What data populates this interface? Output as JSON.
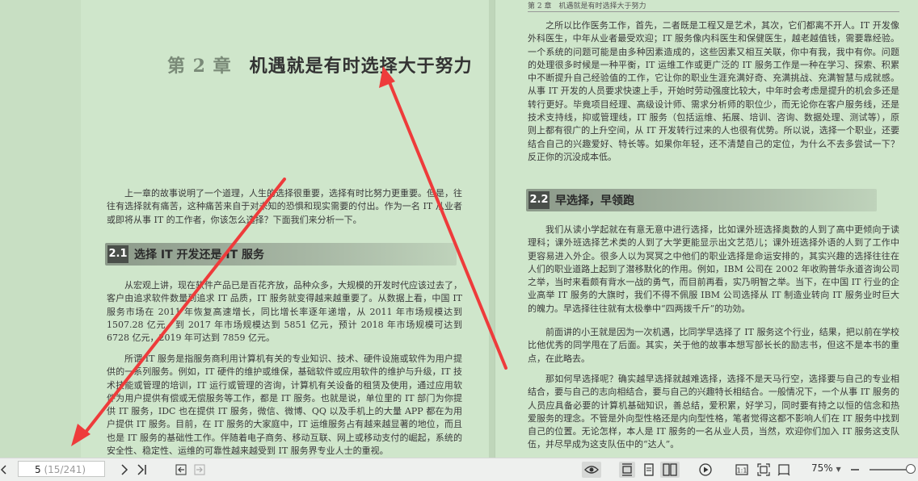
{
  "left_page": {
    "chapter_number": "第 2 章",
    "chapter_title": "机遇就是有时选择大于努力",
    "intro_paragraph": "上一章的故事说明了一个道理，人生的选择很重要，选择有时比努力更重要。但是，往往有选择就有痛苦，这种痛苦来自于对未知的恐惧和现实需要的付出。作为一名 IT 从业者或即将从事 IT 的工作者，你该怎么选择？下面我们来分析一下。",
    "section_badge": "2.1",
    "section_title": "选择 IT 开发还是 IT 服务",
    "para1": "从宏观上讲，现在软件产品已是百花齐放，品种众多，大规模的开发时代应该过去了，客户由追求软件数量到追求 IT 品质，IT 服务就变得越来越重要了。从数据上看，中国 IT 服务市场在 2011 年恢复高速增长，同比增长率逐年递增，从 2011 年市场规模达到 1507.28 亿元，到 2017 年市场规模达到 5851 亿元，预计 2018 年市场规模可达到 6728 亿元，2019 年可达到 7859 亿元。",
    "para2": "所谓 IT 服务是指服务商利用计算机有关的专业知识、技术、硬件设施或软件为用户提供的一系列服务。例如，IT 硬件的维护或维保，基础软件或应用软件的维护与升级，IT 技术技能或管理的培训，IT 运行或管理的咨询，计算机有关设备的租赁及使用，通过应用软件为用户提供有偿或无偿服务等工作，都是 IT 服务。也就是说，单位里的 IT 部门为你提供 IT 服务，IDC 也在提供 IT 服务，微信、微博、QQ 以及手机上的大量 APP 都在为用户提供 IT 服务。目前，在 IT 服务的大家庭中，IT 运维服务占有越来越显著的地位，而且也是 IT 服务的基础性工作。伴随着电子商务、移动互联、网上或移动支付的崛起，系统的安全性、稳定性、运维的可靠性越来越受到 IT 服务界专业人士的重视。"
  },
  "right_page": {
    "running_head": "第 2 章　机遇就是有时选择大于努力",
    "para_top": "之所以比作医务工作，首先，二者既是工程又是艺术，其次，它们都离不开人。IT 开发像外科医生，中年从业者最受欢迎；IT 服务像内科医生和保健医生，越老越值钱，需要靠经验。一个系统的问题可能是由多种因素造成的，这些因素又相互关联，你中有我，我中有你。问题的处理很多时候是一种平衡，IT 运维工作或更广泛的 IT 服务工作是一种在学习、探索、积累中不断提升自己经验值的工作，它让你的职业生涯充满好奇、充满挑战、充满智慧与成就感。从事 IT 开发的人员要求快速上手，开始时劳动强度比较大，中年时会考虑是提升的机会多还是转行更好。毕竟项目经理、高级设计师、需求分析师的职位少，而无论你在客户服务线，还是技术支持线，抑或管理线，IT 服务（包括运维、拓展、培训、咨询、数据处理、测试等），原则上都有很广的上升空间，从 IT 开发转行过来的人也很有优势。所以说，选择一个职业，还要结合自己的兴趣爱好、特长等。如果你年轻，还不清楚自己的定位，为什么不去多尝试一下？反正你的沉没成本低。",
    "section_badge": "2.2",
    "section_title": "早选择，早领跑",
    "para1": "我们从读小学起就在有意无意中进行选择，比如课外班选择奥数的人到了高中更倾向于读理科；课外班选择艺术类的人到了大学更能显示出文艺范儿；课外班选择外语的人到了工作中更容易进入外企。很多人以为冥冥之中他们的职业选择是命运安排的，其实兴趣的选择往往在人们的职业道路上起到了潜移默化的作用。例如，IBM 公司在 2002 年收购普华永道咨询公司之举，当时来看颇有背水一战的勇气，而目前再看，实乃明智之举。当下，在中国 IT 行业的企业高举 IT 服务的大旗时，我们不得不佩服 IBM 公司选择从 IT 制造业转向 IT 服务业时巨大的魄力。早选择往往就有太极拳中“四两拨千斤”的功効。",
    "para2": "前面讲的小王就是因为一次机遇，比同学早选择了 IT 服务这个行业，结果，把以前在学校比他优秀的同学甩在了后面。其实，关于他的故事本想写部长长的励志书，但这不是本书的重点，在此略去。",
    "para3": "那如何早选择呢？确实越早选择就越难选择，选择不是天马行空，选择要与自己的专业相结合，要与自己的志向相结合，要与自己的兴趣特长相结合。一般情况下，一个从事 IT 服务的人员应具备必要的计算机基础知识，善总结，爱积累，好学习，同时要有持之以恒的信念和热爱服务的理念。不管是外向型性格还是内向型性格，笔者觉得这都不影响人们在 IT 服务中找到自己的位置。无论怎样，本人是 IT 服务的一名从业人员，当然，欢迎你们加入 IT 服务这支队伍，并尽早成为这支队伍中的“达人”。"
  },
  "toolbar": {
    "page_current": "5",
    "page_total": " (15/241)",
    "zoom": "75%"
  },
  "colors": {
    "arrow": "#ee3b3b",
    "page_bg": "#cfe6cb"
  }
}
